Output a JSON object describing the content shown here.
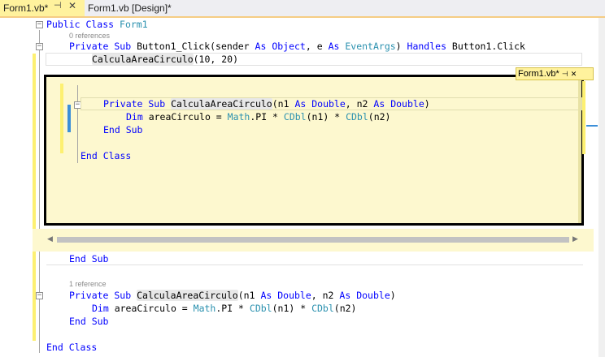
{
  "tabs": [
    {
      "label": "Form1.vb*",
      "active": true
    },
    {
      "label": "Form1.vb [Design]*",
      "active": false
    }
  ],
  "tab_pin_icon": "pin-icon",
  "tab_close_icon": "close-icon",
  "peek_tab_label": "Form1.vb*",
  "code": {
    "line1_kw": "Public Class",
    "line1_name": "Form1",
    "refs0": "0 references",
    "sub1_private": "Private Sub",
    "sub1_name": "Button1_Click",
    "sub1_open": "(sender ",
    "sub1_as1": "As",
    "sub1_obj": "Object",
    "sub1_mid": ", e ",
    "sub1_as2": "As",
    "sub1_ev": "EventArgs",
    "sub1_close": ") ",
    "sub1_handles": "Handles",
    "sub1_target": " Button1.Click",
    "call_name": "CalculaAreaCirculo",
    "call_args": "(10, 20)",
    "endsub": "End Sub",
    "refs1": "1 reference",
    "sub2_private": "Private Sub",
    "sub2_name": "CalculaAreaCirculo",
    "sub2_p1": "(n1 ",
    "sub2_as1": "As",
    "sub2_dbl1": "Double",
    "sub2_p2": ", n2 ",
    "sub2_as2": "As",
    "sub2_dbl2": "Double",
    "sub2_p3": ")",
    "dim_kw": "Dim",
    "dim_var": " areaCirculo = ",
    "dim_math": "Math",
    "dim_pi": ".PI * ",
    "dim_cdbl1": "CDbl",
    "dim_n1": "(n1) * ",
    "dim_cdbl2": "CDbl",
    "dim_n2": "(n2)",
    "endclass": "End Class"
  }
}
